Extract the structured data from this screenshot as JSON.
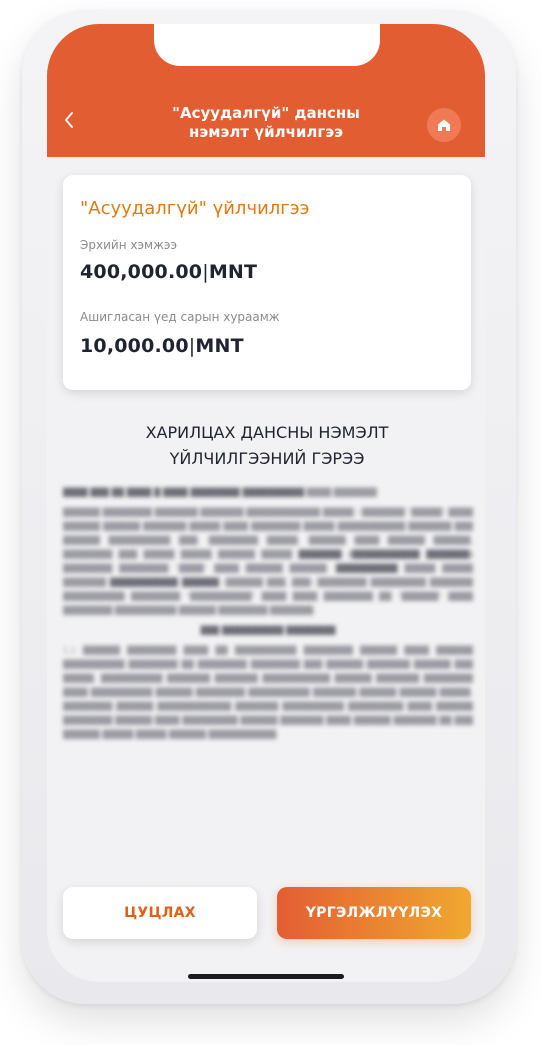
{
  "header": {
    "title_line1": "\"Асуудалгүй\" дансны",
    "title_line2": "нэмэлт үйлчилгээ"
  },
  "service_card": {
    "title": "\"Асуудалгүй\" үйлчилгээ",
    "limit_label": "Эрхийн хэмжээ",
    "limit_amount": "400,000.00",
    "limit_currency": "MNT",
    "fee_label": "Ашигласан үед сарын хураамж",
    "fee_amount": "10,000.00",
    "fee_currency": "MNT"
  },
  "contract": {
    "title_line1": "ХАРИЛЦАХ ДАНСНЫ НЭМЭЛТ",
    "title_line2": "ҮЙЛЧИЛГЭЭНИЙ ГЭРЭЭ"
  },
  "buttons": {
    "cancel": "ЦУЦЛАХ",
    "continue": "ҮРГЭЛЖЛҮҮЛЭХ"
  },
  "colors": {
    "header": "#e35d33",
    "accent_text": "#e07a12",
    "gradient_start": "#e35d33",
    "gradient_end": "#f0a830"
  },
  "icons": {
    "back": "chevron-left-icon",
    "home": "home-icon"
  }
}
